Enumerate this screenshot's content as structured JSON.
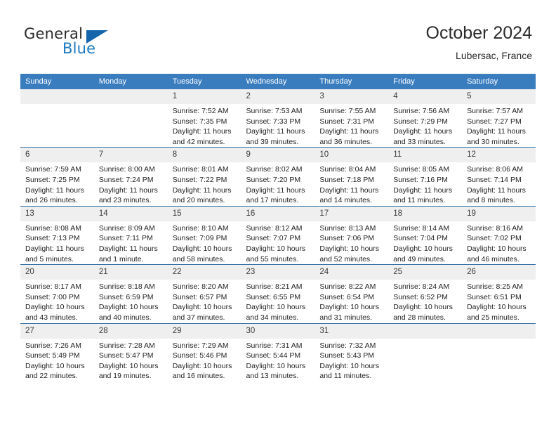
{
  "brand": {
    "name_top": "General",
    "name_bottom": "Blue",
    "accent_color": "#1565ad",
    "text_color": "#2b2b2b"
  },
  "header": {
    "title": "October 2024",
    "subtitle": "Lubersac, France"
  },
  "calendar": {
    "header_bg": "#3a7dbf",
    "row_border": "#2e6da4",
    "daynum_bg": "#efefef",
    "weekdays": [
      "Sunday",
      "Monday",
      "Tuesday",
      "Wednesday",
      "Thursday",
      "Friday",
      "Saturday"
    ],
    "weeks": [
      [
        {
          "day": "",
          "lines": []
        },
        {
          "day": "",
          "lines": []
        },
        {
          "day": "1",
          "lines": [
            "Sunrise: 7:52 AM",
            "Sunset: 7:35 PM",
            "Daylight: 11 hours",
            "and 42 minutes."
          ]
        },
        {
          "day": "2",
          "lines": [
            "Sunrise: 7:53 AM",
            "Sunset: 7:33 PM",
            "Daylight: 11 hours",
            "and 39 minutes."
          ]
        },
        {
          "day": "3",
          "lines": [
            "Sunrise: 7:55 AM",
            "Sunset: 7:31 PM",
            "Daylight: 11 hours",
            "and 36 minutes."
          ]
        },
        {
          "day": "4",
          "lines": [
            "Sunrise: 7:56 AM",
            "Sunset: 7:29 PM",
            "Daylight: 11 hours",
            "and 33 minutes."
          ]
        },
        {
          "day": "5",
          "lines": [
            "Sunrise: 7:57 AM",
            "Sunset: 7:27 PM",
            "Daylight: 11 hours",
            "and 30 minutes."
          ]
        }
      ],
      [
        {
          "day": "6",
          "lines": [
            "Sunrise: 7:59 AM",
            "Sunset: 7:25 PM",
            "Daylight: 11 hours",
            "and 26 minutes."
          ]
        },
        {
          "day": "7",
          "lines": [
            "Sunrise: 8:00 AM",
            "Sunset: 7:24 PM",
            "Daylight: 11 hours",
            "and 23 minutes."
          ]
        },
        {
          "day": "8",
          "lines": [
            "Sunrise: 8:01 AM",
            "Sunset: 7:22 PM",
            "Daylight: 11 hours",
            "and 20 minutes."
          ]
        },
        {
          "day": "9",
          "lines": [
            "Sunrise: 8:02 AM",
            "Sunset: 7:20 PM",
            "Daylight: 11 hours",
            "and 17 minutes."
          ]
        },
        {
          "day": "10",
          "lines": [
            "Sunrise: 8:04 AM",
            "Sunset: 7:18 PM",
            "Daylight: 11 hours",
            "and 14 minutes."
          ]
        },
        {
          "day": "11",
          "lines": [
            "Sunrise: 8:05 AM",
            "Sunset: 7:16 PM",
            "Daylight: 11 hours",
            "and 11 minutes."
          ]
        },
        {
          "day": "12",
          "lines": [
            "Sunrise: 8:06 AM",
            "Sunset: 7:14 PM",
            "Daylight: 11 hours",
            "and 8 minutes."
          ]
        }
      ],
      [
        {
          "day": "13",
          "lines": [
            "Sunrise: 8:08 AM",
            "Sunset: 7:13 PM",
            "Daylight: 11 hours",
            "and 5 minutes."
          ]
        },
        {
          "day": "14",
          "lines": [
            "Sunrise: 8:09 AM",
            "Sunset: 7:11 PM",
            "Daylight: 11 hours",
            "and 1 minute."
          ]
        },
        {
          "day": "15",
          "lines": [
            "Sunrise: 8:10 AM",
            "Sunset: 7:09 PM",
            "Daylight: 10 hours",
            "and 58 minutes."
          ]
        },
        {
          "day": "16",
          "lines": [
            "Sunrise: 8:12 AM",
            "Sunset: 7:07 PM",
            "Daylight: 10 hours",
            "and 55 minutes."
          ]
        },
        {
          "day": "17",
          "lines": [
            "Sunrise: 8:13 AM",
            "Sunset: 7:06 PM",
            "Daylight: 10 hours",
            "and 52 minutes."
          ]
        },
        {
          "day": "18",
          "lines": [
            "Sunrise: 8:14 AM",
            "Sunset: 7:04 PM",
            "Daylight: 10 hours",
            "and 49 minutes."
          ]
        },
        {
          "day": "19",
          "lines": [
            "Sunrise: 8:16 AM",
            "Sunset: 7:02 PM",
            "Daylight: 10 hours",
            "and 46 minutes."
          ]
        }
      ],
      [
        {
          "day": "20",
          "lines": [
            "Sunrise: 8:17 AM",
            "Sunset: 7:00 PM",
            "Daylight: 10 hours",
            "and 43 minutes."
          ]
        },
        {
          "day": "21",
          "lines": [
            "Sunrise: 8:18 AM",
            "Sunset: 6:59 PM",
            "Daylight: 10 hours",
            "and 40 minutes."
          ]
        },
        {
          "day": "22",
          "lines": [
            "Sunrise: 8:20 AM",
            "Sunset: 6:57 PM",
            "Daylight: 10 hours",
            "and 37 minutes."
          ]
        },
        {
          "day": "23",
          "lines": [
            "Sunrise: 8:21 AM",
            "Sunset: 6:55 PM",
            "Daylight: 10 hours",
            "and 34 minutes."
          ]
        },
        {
          "day": "24",
          "lines": [
            "Sunrise: 8:22 AM",
            "Sunset: 6:54 PM",
            "Daylight: 10 hours",
            "and 31 minutes."
          ]
        },
        {
          "day": "25",
          "lines": [
            "Sunrise: 8:24 AM",
            "Sunset: 6:52 PM",
            "Daylight: 10 hours",
            "and 28 minutes."
          ]
        },
        {
          "day": "26",
          "lines": [
            "Sunrise: 8:25 AM",
            "Sunset: 6:51 PM",
            "Daylight: 10 hours",
            "and 25 minutes."
          ]
        }
      ],
      [
        {
          "day": "27",
          "lines": [
            "Sunrise: 7:26 AM",
            "Sunset: 5:49 PM",
            "Daylight: 10 hours",
            "and 22 minutes."
          ]
        },
        {
          "day": "28",
          "lines": [
            "Sunrise: 7:28 AM",
            "Sunset: 5:47 PM",
            "Daylight: 10 hours",
            "and 19 minutes."
          ]
        },
        {
          "day": "29",
          "lines": [
            "Sunrise: 7:29 AM",
            "Sunset: 5:46 PM",
            "Daylight: 10 hours",
            "and 16 minutes."
          ]
        },
        {
          "day": "30",
          "lines": [
            "Sunrise: 7:31 AM",
            "Sunset: 5:44 PM",
            "Daylight: 10 hours",
            "and 13 minutes."
          ]
        },
        {
          "day": "31",
          "lines": [
            "Sunrise: 7:32 AM",
            "Sunset: 5:43 PM",
            "Daylight: 10 hours",
            "and 11 minutes."
          ]
        },
        {
          "day": "",
          "lines": []
        },
        {
          "day": "",
          "lines": []
        }
      ]
    ]
  }
}
